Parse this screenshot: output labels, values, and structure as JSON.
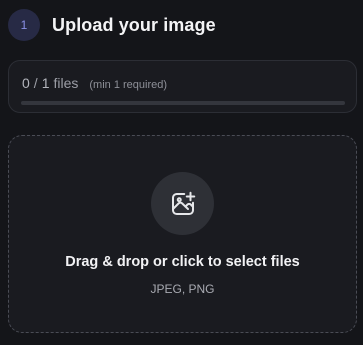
{
  "step": {
    "number": "1",
    "title": "Upload your image"
  },
  "progress": {
    "current": "0",
    "separator": "/",
    "total": "1",
    "unit": "files",
    "requirement_note": "(min 1 required)",
    "fraction": 0
  },
  "dropzone": {
    "icon": "image-add-icon",
    "title": "Drag & drop or click to select files",
    "accepted_formats": "JPEG, PNG"
  },
  "colors": {
    "background": "#141519",
    "accent": "#7a80e8",
    "card": "#1a1b20"
  }
}
